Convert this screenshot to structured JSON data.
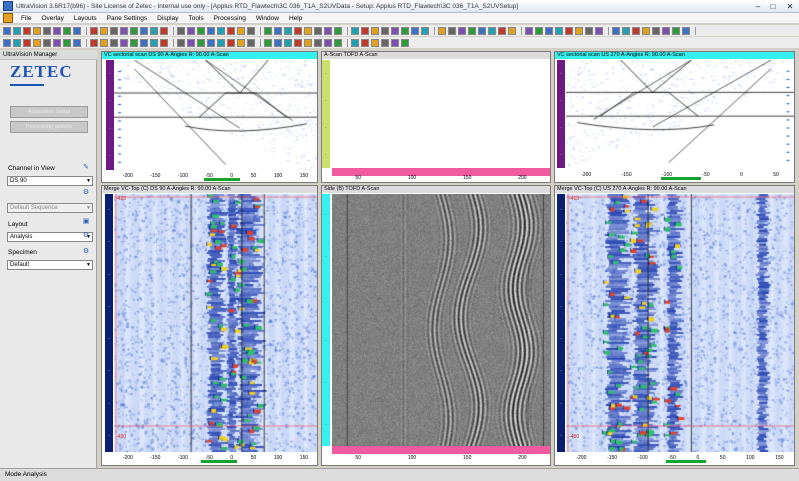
{
  "window": {
    "title": "UltraVision 3.6R17(b96) - Site License of Zetec - Internal use only - [Applus RTD_Flawtech\\3C 036_T1A_S2UVData - Setup: Applus RTD_Flawtech\\3C 036_T1A_S2UVSetup]",
    "minimize": "–",
    "maximize": "□",
    "close": "✕"
  },
  "menu": [
    "File",
    "Overlay",
    "Layouts",
    "Pane Settings",
    "Display",
    "Tools",
    "Processing",
    "Window",
    "Help"
  ],
  "left_panel": {
    "header": "UltraVision Manager",
    "logo": "ZETEC",
    "buttons": [
      "Acquisition Setup",
      "Processing options"
    ],
    "channel_label": "Channel in View",
    "channel_value": "DS 90",
    "sequence_placeholder": "Default Sequence",
    "layout_label": "Layout",
    "layout_value": "Analysis",
    "specimen_label": "Specimen",
    "specimen_value": "Default",
    "arrow": "▼"
  },
  "status": {
    "mode": "Mode Analysis"
  },
  "panels": {
    "top_left": {
      "header": "VC sectorial scan DS 90 A-Angles R: 90.00 A-Scan",
      "axis": [
        "-200",
        "-150",
        "-100",
        "-50",
        "0",
        "50",
        "100",
        "150"
      ]
    },
    "top_mid": {
      "header": "A-Scan TOFD A-Scan",
      "axis": [
        "50",
        "100",
        "150",
        "200"
      ]
    },
    "top_right": {
      "header": "VC sectorial scan US 270 A-Angles R: 90.00 A-Scan",
      "axis": [
        "-200",
        "-150",
        "-100",
        "-50",
        "0",
        "50"
      ]
    },
    "bottom_left": {
      "header": "Merge VC-Top (C) DS 90 A-Angles R: 90.00 A-Scan",
      "marker_top": "-423",
      "marker_bottom": "-450",
      "axis": [
        "-200",
        "-150",
        "-100",
        "-50",
        "0",
        "50",
        "100",
        "150"
      ]
    },
    "bottom_mid": {
      "header": "Side (B) TOFD A-Scan",
      "axis": [
        "50",
        "100",
        "150",
        "200"
      ]
    },
    "bottom_right": {
      "header": "Merge VC-Top (C) US 270 A-Angles R: 90.00 A-Scan",
      "marker_top": "-413",
      "marker_bottom": "-450",
      "axis": [
        "-200",
        "-150",
        "-100",
        "-50",
        "0",
        "50",
        "100",
        "150"
      ]
    }
  },
  "colors": {
    "cyan": "#34f0ef",
    "pink": "#f05ba0",
    "purple": "#6d1a84",
    "navy": "#0a1f72",
    "green": "#18a32c",
    "blue": "#1d55b4"
  }
}
